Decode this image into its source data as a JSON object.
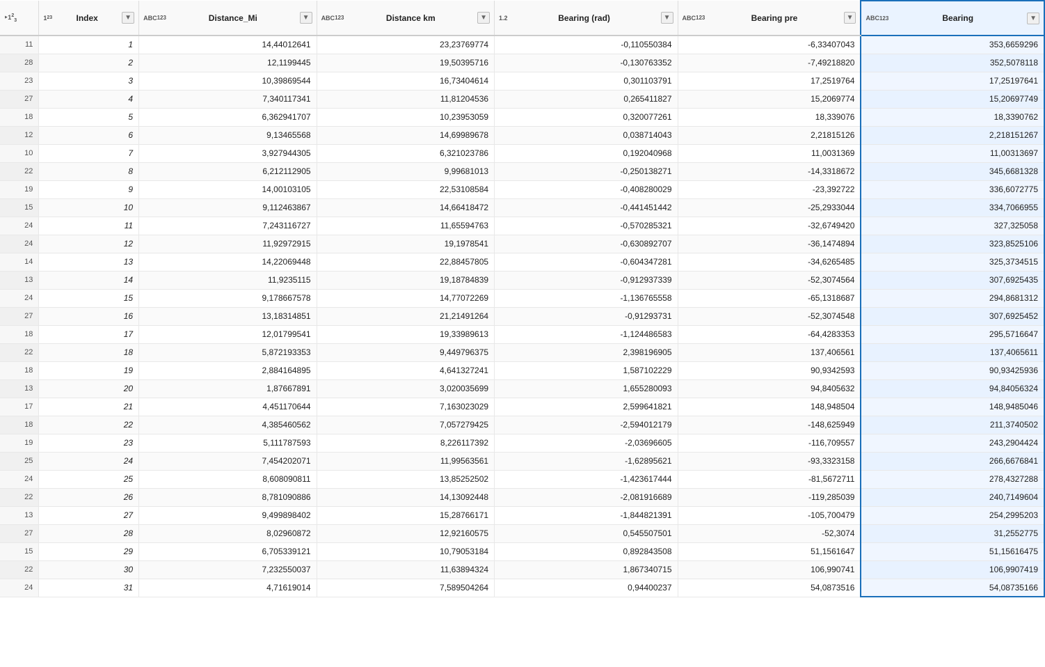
{
  "columns": [
    {
      "id": "row_num",
      "label": "",
      "type": "index_row",
      "width": 35
    },
    {
      "id": "index",
      "label": "Index",
      "type": "123",
      "width": 90
    },
    {
      "id": "distance_mi",
      "label": "Distance_Mi",
      "type": "ABC_123",
      "width": 160
    },
    {
      "id": "distance_km",
      "label": "Distance km",
      "type": "ABC_123",
      "width": 160
    },
    {
      "id": "bearing_rad",
      "label": "Bearing (rad)",
      "type": "12",
      "width": 165
    },
    {
      "id": "bearing_pre",
      "label": "Bearing pre",
      "type": "ABC_123",
      "width": 165
    },
    {
      "id": "bearing",
      "label": "Bearing",
      "type": "ABC_123",
      "width": 165,
      "highlighted": true
    }
  ],
  "rows": [
    {
      "row_num": "11",
      "index": 1,
      "distance_mi": "14,44012641",
      "distance_km": "23,23769774",
      "bearing_rad": "-0,110550384",
      "bearing_pre": "-6,33407043",
      "bearing": "353,6659296"
    },
    {
      "row_num": "28",
      "index": 2,
      "distance_mi": "12,1199445",
      "distance_km": "19,50395716",
      "bearing_rad": "-0,130763352",
      "bearing_pre": "-7,49218820",
      "bearing": "352,5078118"
    },
    {
      "row_num": "23",
      "index": 3,
      "distance_mi": "10,39869544",
      "distance_km": "16,73404614",
      "bearing_rad": "0,301103791",
      "bearing_pre": "17,2519764",
      "bearing": "17,25197641"
    },
    {
      "row_num": "27",
      "index": 4,
      "distance_mi": "7,340117341",
      "distance_km": "11,81204536",
      "bearing_rad": "0,265411827",
      "bearing_pre": "15,2069774",
      "bearing": "15,20697749"
    },
    {
      "row_num": "18",
      "index": 5,
      "distance_mi": "6,362941707",
      "distance_km": "10,23953059",
      "bearing_rad": "0,320077261",
      "bearing_pre": "18,339076",
      "bearing": "18,3390762"
    },
    {
      "row_num": "12",
      "index": 6,
      "distance_mi": "9,13465568",
      "distance_km": "14,69989678",
      "bearing_rad": "0,038714043",
      "bearing_pre": "2,21815126",
      "bearing": "2,218151267"
    },
    {
      "row_num": "10",
      "index": 7,
      "distance_mi": "3,927944305",
      "distance_km": "6,321023786",
      "bearing_rad": "0,192040968",
      "bearing_pre": "11,0031369",
      "bearing": "11,00313697"
    },
    {
      "row_num": "22",
      "index": 8,
      "distance_mi": "6,212112905",
      "distance_km": "9,99681013",
      "bearing_rad": "-0,250138271",
      "bearing_pre": "-14,3318672",
      "bearing": "345,6681328"
    },
    {
      "row_num": "19",
      "index": 9,
      "distance_mi": "14,00103105",
      "distance_km": "22,53108584",
      "bearing_rad": "-0,408280029",
      "bearing_pre": "-23,392722",
      "bearing": "336,6072775"
    },
    {
      "row_num": "15",
      "index": 10,
      "distance_mi": "9,112463867",
      "distance_km": "14,66418472",
      "bearing_rad": "-0,441451442",
      "bearing_pre": "-25,2933044",
      "bearing": "334,7066955"
    },
    {
      "row_num": "24",
      "index": 11,
      "distance_mi": "7,243116727",
      "distance_km": "11,65594763",
      "bearing_rad": "-0,570285321",
      "bearing_pre": "-32,6749420",
      "bearing": "327,325058"
    },
    {
      "row_num": "24",
      "index": 12,
      "distance_mi": "11,92972915",
      "distance_km": "19,1978541",
      "bearing_rad": "-0,630892707",
      "bearing_pre": "-36,1474894",
      "bearing": "323,8525106"
    },
    {
      "row_num": "14",
      "index": 13,
      "distance_mi": "14,22069448",
      "distance_km": "22,88457805",
      "bearing_rad": "-0,604347281",
      "bearing_pre": "-34,6265485",
      "bearing": "325,3734515"
    },
    {
      "row_num": "13",
      "index": 14,
      "distance_mi": "11,9235115",
      "distance_km": "19,18784839",
      "bearing_rad": "-0,912937339",
      "bearing_pre": "-52,3074564",
      "bearing": "307,6925435"
    },
    {
      "row_num": "24",
      "index": 15,
      "distance_mi": "9,178667578",
      "distance_km": "14,77072269",
      "bearing_rad": "-1,136765558",
      "bearing_pre": "-65,1318687",
      "bearing": "294,8681312"
    },
    {
      "row_num": "27",
      "index": 16,
      "distance_mi": "13,18314851",
      "distance_km": "21,21491264",
      "bearing_rad": "-0,91293731",
      "bearing_pre": "-52,3074548",
      "bearing": "307,6925452"
    },
    {
      "row_num": "18",
      "index": 17,
      "distance_mi": "12,01799541",
      "distance_km": "19,33989613",
      "bearing_rad": "-1,124486583",
      "bearing_pre": "-64,4283353",
      "bearing": "295,5716647"
    },
    {
      "row_num": "22",
      "index": 18,
      "distance_mi": "5,872193353",
      "distance_km": "9,449796375",
      "bearing_rad": "2,398196905",
      "bearing_pre": "137,406561",
      "bearing": "137,4065611"
    },
    {
      "row_num": "18",
      "index": 19,
      "distance_mi": "2,884164895",
      "distance_km": "4,641327241",
      "bearing_rad": "1,587102229",
      "bearing_pre": "90,9342593",
      "bearing": "90,93425936"
    },
    {
      "row_num": "13",
      "index": 20,
      "distance_mi": "1,87667891",
      "distance_km": "3,020035699",
      "bearing_rad": "1,655280093",
      "bearing_pre": "94,8405632",
      "bearing": "94,84056324"
    },
    {
      "row_num": "17",
      "index": 21,
      "distance_mi": "4,451170644",
      "distance_km": "7,163023029",
      "bearing_rad": "2,599641821",
      "bearing_pre": "148,948504",
      "bearing": "148,9485046"
    },
    {
      "row_num": "18",
      "index": 22,
      "distance_mi": "4,385460562",
      "distance_km": "7,057279425",
      "bearing_rad": "-2,594012179",
      "bearing_pre": "-148,625949",
      "bearing": "211,3740502"
    },
    {
      "row_num": "19",
      "index": 23,
      "distance_mi": "5,111787593",
      "distance_km": "8,226117392",
      "bearing_rad": "-2,03696605",
      "bearing_pre": "-116,709557",
      "bearing": "243,2904424"
    },
    {
      "row_num": "25",
      "index": 24,
      "distance_mi": "7,454202071",
      "distance_km": "11,99563561",
      "bearing_rad": "-1,62895621",
      "bearing_pre": "-93,3323158",
      "bearing": "266,6676841"
    },
    {
      "row_num": "24",
      "index": 25,
      "distance_mi": "8,608090811",
      "distance_km": "13,85252502",
      "bearing_rad": "-1,423617444",
      "bearing_pre": "-81,5672711",
      "bearing": "278,4327288"
    },
    {
      "row_num": "22",
      "index": 26,
      "distance_mi": "8,781090886",
      "distance_km": "14,13092448",
      "bearing_rad": "-2,081916689",
      "bearing_pre": "-119,285039",
      "bearing": "240,7149604"
    },
    {
      "row_num": "13",
      "index": 27,
      "distance_mi": "9,499898402",
      "distance_km": "15,28766171",
      "bearing_rad": "-1,844821391",
      "bearing_pre": "-105,700479",
      "bearing": "254,2995203"
    },
    {
      "row_num": "27",
      "index": 28,
      "distance_mi": "8,02960872",
      "distance_km": "12,92160575",
      "bearing_rad": "0,545507501",
      "bearing_pre": "-52,3074",
      "bearing": "31,2552775"
    },
    {
      "row_num": "15",
      "index": 29,
      "distance_mi": "6,705339121",
      "distance_km": "10,79053184",
      "bearing_rad": "0,892843508",
      "bearing_pre": "51,1561647",
      "bearing": "51,15616475"
    },
    {
      "row_num": "22",
      "index": 30,
      "distance_mi": "7,232550037",
      "distance_km": "11,63894324",
      "bearing_rad": "1,867340715",
      "bearing_pre": "106,990741",
      "bearing": "106,9907419"
    },
    {
      "row_num": "24",
      "index": 31,
      "distance_mi": "4,71619014",
      "distance_km": "7,589504264",
      "bearing_rad": "0,94400237",
      "bearing_pre": "54,0873516",
      "bearing": "54,08735166"
    }
  ]
}
